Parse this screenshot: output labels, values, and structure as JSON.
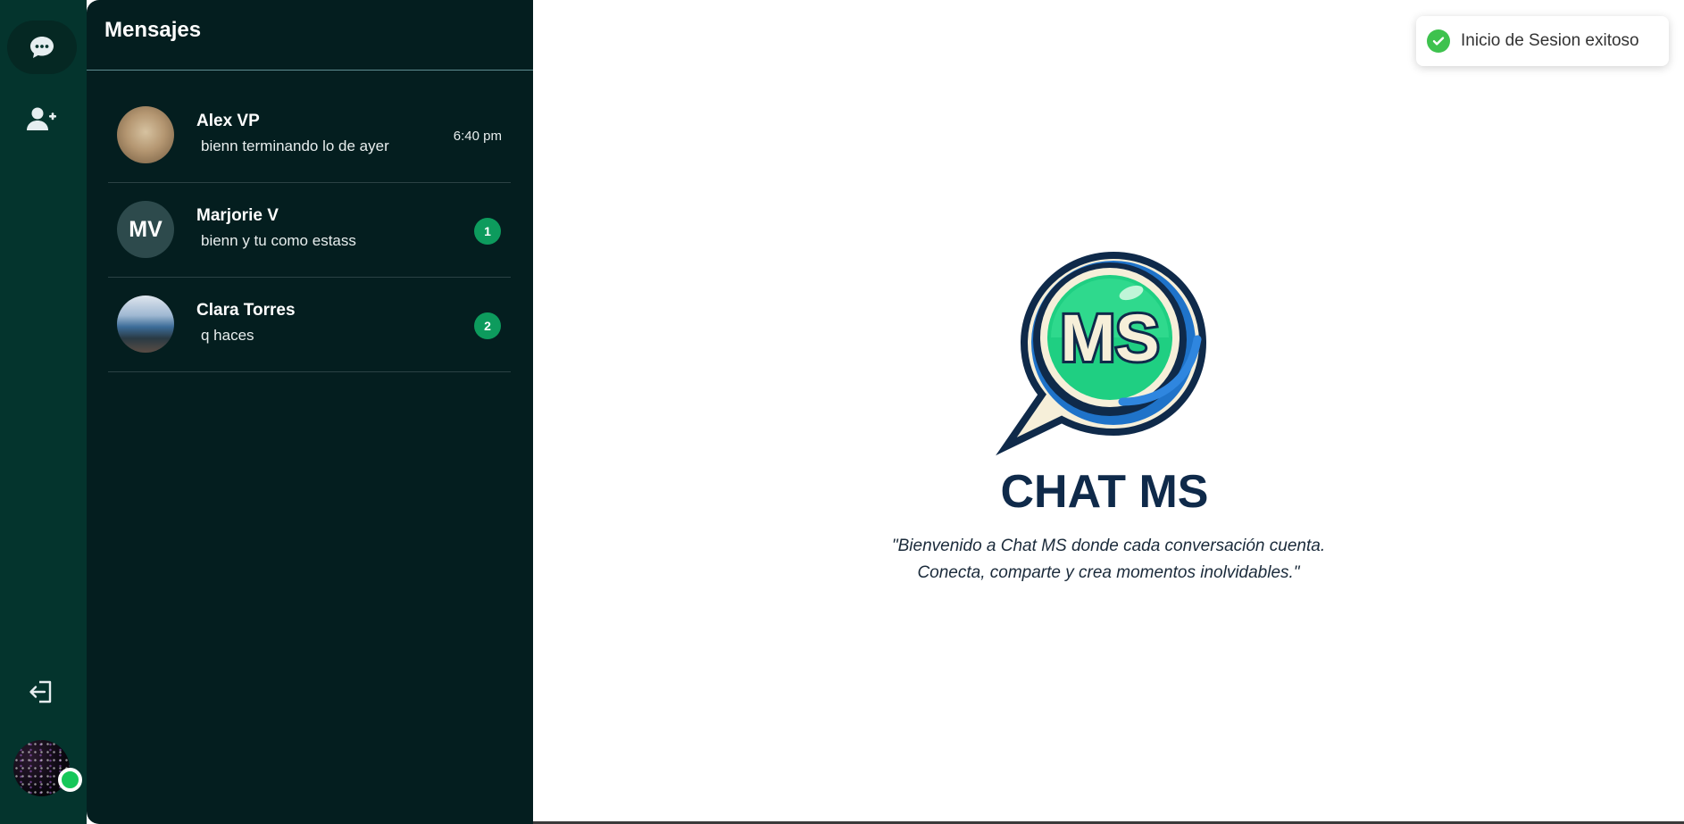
{
  "sidebar": {
    "icons": [
      "chat-bubble-icon",
      "add-user-icon",
      "logout-icon"
    ],
    "user_online": true
  },
  "panel": {
    "title": "Mensajes",
    "chats": [
      {
        "name": "Alex VP",
        "preview": " bienn terminando lo de ayer",
        "time": "6:40 pm",
        "unread": "",
        "avatar": "photo-cat"
      },
      {
        "name": "Marjorie V",
        "preview": " bienn y tu como estass",
        "time": "",
        "unread": "1",
        "avatar_initials": "MV"
      },
      {
        "name": "Clara Torres",
        "preview": " q haces",
        "time": "",
        "unread": "2",
        "avatar": "photo-coast"
      }
    ]
  },
  "main": {
    "logo_text_top": "MS",
    "logo_text_bottom": "CHAT MS",
    "welcome_line1": "\"Bienvenido a Chat MS donde cada conversación cuenta.",
    "welcome_line2": "Conecta, comparte y crea momentos inolvidables.\""
  },
  "toast": {
    "message": "Inicio de Sesion exitoso",
    "icon": "check-circle-icon"
  },
  "colors": {
    "rail": "#04342d",
    "panel": "#041e1f",
    "badge": "#0d9b5d",
    "online": "#16c75a",
    "success": "#3ec24e"
  }
}
